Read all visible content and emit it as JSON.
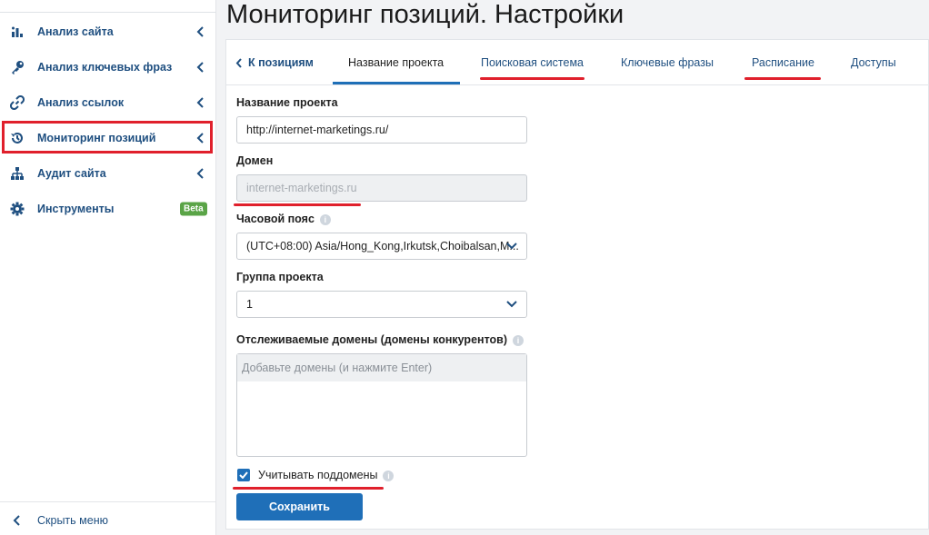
{
  "sidebar": {
    "items": [
      {
        "label": "Анализ сайта",
        "icon": "bar-chart-icon"
      },
      {
        "label": "Анализ ключевых фраз",
        "icon": "key-icon"
      },
      {
        "label": "Анализ ссылок",
        "icon": "link-icon"
      },
      {
        "label": "Мониторинг позиций",
        "icon": "history-icon"
      },
      {
        "label": "Аудит сайта",
        "icon": "sitemap-icon"
      },
      {
        "label": "Инструменты",
        "icon": "gear-icon",
        "badge": "Beta"
      }
    ],
    "hide_menu": "Скрыть меню"
  },
  "page": {
    "title": "Мониторинг позиций. Настройки"
  },
  "tabs": {
    "back": "К позициям",
    "items": [
      "Название проекта",
      "Поисковая система",
      "Ключевые фразы",
      "Расписание",
      "Доступы"
    ]
  },
  "form": {
    "project_name_label": "Название проекта",
    "project_name_value": "http://internet-marketings.ru/",
    "domain_label": "Домен",
    "domain_value": "internet-marketings.ru",
    "timezone_label": "Часовой пояс",
    "timezone_value": "(UTC+08:00) Asia/Hong_Kong,Irkutsk,Choibalsan,M...",
    "group_label": "Группа проекта",
    "group_value": "1",
    "competitors_label": "Отслеживаемые домены (домены конкурентов)",
    "competitors_placeholder": "Добавьте домены (и нажмите Enter)",
    "subdomains_label": "Учитывать поддомены",
    "subdomains_checked": true,
    "save_label": "Сохранить"
  },
  "colors": {
    "accent": "#1f6fb8",
    "link": "#1f4f80",
    "highlight": "#e0202c",
    "badge": "#5aa447"
  }
}
